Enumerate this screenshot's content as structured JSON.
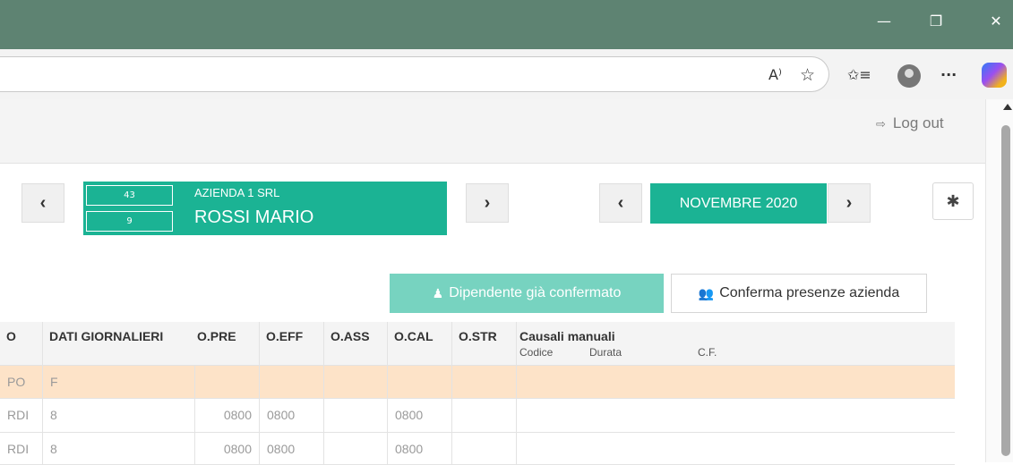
{
  "window": {
    "minimize": "—",
    "restore": "❐",
    "close": "✕"
  },
  "toolbar": {
    "read_aloud": "A⁾",
    "favorite": "☆",
    "favorites_list": "✩≡",
    "more": "···"
  },
  "header": {
    "logout_icon": "⇨",
    "logout_label": "Log out"
  },
  "employee": {
    "company_code": "43",
    "company_name": "AZIENDA 1 SRL",
    "employee_code": "9",
    "employee_name": "ROSSI MARIO"
  },
  "nav": {
    "prev": "‹",
    "next": "›"
  },
  "period": {
    "month_label": "NOVEMBRE 2020"
  },
  "settings": {
    "gear": "✱"
  },
  "actions": {
    "confirmed_icon": "♟",
    "confirmed_label": "Dipendente già confermato",
    "conferma_icon": "👥",
    "conferma_label": "Conferma presenze azienda"
  },
  "table": {
    "headers": {
      "c0": "O",
      "dati": "DATI GIORNALIERI",
      "opre": "O.PRE",
      "oeff": "O.EFF",
      "oass": "O.ASS",
      "ocal": "O.CAL",
      "ostr": "O.STR",
      "causali": "Causali manuali",
      "codice": "Codice",
      "durata": "Durata",
      "cf": "C.F."
    },
    "rows": [
      {
        "c0": "PO",
        "dati": "F",
        "opre": "",
        "oeff": "",
        "oass": "",
        "ocal": "",
        "ostr": ""
      },
      {
        "c0": "RDI",
        "dati": "8",
        "opre": "0800",
        "oeff": "0800",
        "oass": "",
        "ocal": "0800",
        "ostr": ""
      },
      {
        "c0": "RDI",
        "dati": "8",
        "opre": "0800",
        "oeff": "0800",
        "oass": "",
        "ocal": "0800",
        "ostr": ""
      }
    ]
  }
}
